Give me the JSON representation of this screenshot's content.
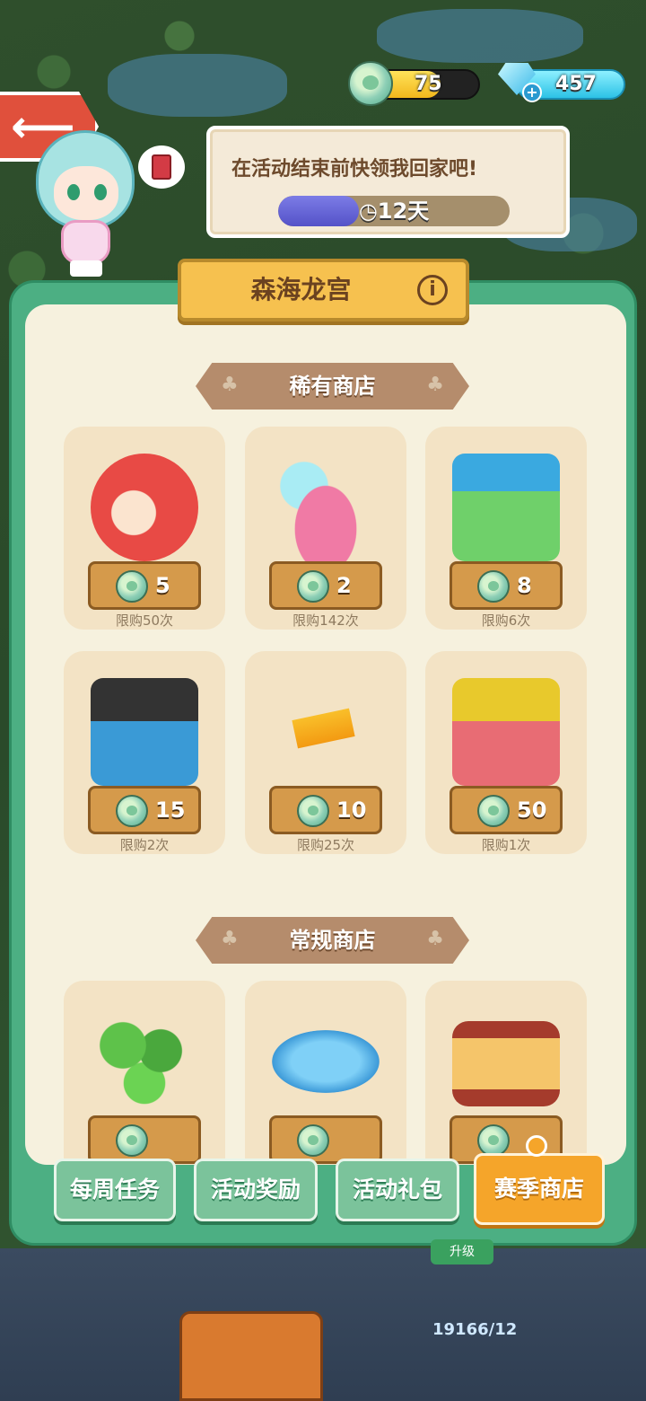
{
  "resources": {
    "leaf_currency": "75",
    "gems": "457",
    "leaf_fill_fraction": 0.65
  },
  "character_speech": "在活动结束前快领我回家吧!",
  "timer": {
    "label": "12天",
    "fill_fraction": 0.35
  },
  "title": "森海龙宫",
  "rare_shop": {
    "heading": "稀有商店",
    "items": [
      {
        "icon": "red-shrimp-icon",
        "price": "5",
        "limit": "限购50次"
      },
      {
        "icon": "coral-icon",
        "price": "2",
        "limit": "限购142次"
      },
      {
        "icon": "mystery-box-icon",
        "price": "8",
        "limit": "限购6次"
      },
      {
        "icon": "blue-cat-box-icon",
        "price": "15",
        "limit": "限购2次"
      },
      {
        "icon": "ticket-icon",
        "price": "10",
        "limit": "限购25次"
      },
      {
        "icon": "pink-cat-box-icon",
        "price": "50",
        "limit": "限购1次"
      }
    ]
  },
  "regular_shop": {
    "heading": "常规商店",
    "items": [
      {
        "icon": "plant-icon"
      },
      {
        "icon": "water-puddle-icon"
      },
      {
        "icon": "toaster-icon"
      }
    ]
  },
  "tabs": [
    {
      "label": "每周任务",
      "active": false
    },
    {
      "label": "活动奖励",
      "active": false
    },
    {
      "label": "活动礼包",
      "active": false
    },
    {
      "label": "赛季商店",
      "active": true
    }
  ],
  "background": {
    "sign_text": "升级",
    "counter_text": "19166/12"
  },
  "colors": {
    "panel_green": "#4caf83",
    "active_tab": "#f5a52a",
    "price_plate": "#d59a4b"
  }
}
